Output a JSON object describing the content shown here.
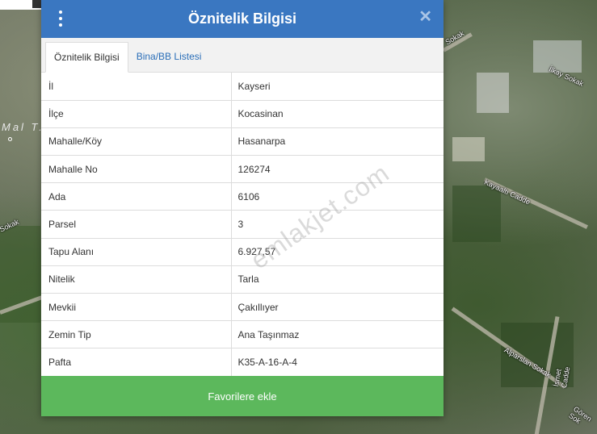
{
  "map": {
    "left_text": "Mal T.",
    "street_labels": [
      "Sokak",
      "İlkay Sokak",
      "Kayaaltı Cadde",
      "Sokak",
      "Alparslan Sokak",
      "İsmet Cadde",
      "Gören Sok"
    ]
  },
  "dialog": {
    "title": "Öznitelik Bilgisi",
    "close_symbol": "✕",
    "tabs": [
      {
        "label": "Öznitelik Bilgisi",
        "active": true
      },
      {
        "label": "Bina/BB Listesi",
        "active": false
      }
    ],
    "rows": [
      {
        "label": "İl",
        "value": "Kayseri"
      },
      {
        "label": "İlçe",
        "value": "Kocasinan"
      },
      {
        "label": "Mahalle/Köy",
        "value": "Hasanarpa"
      },
      {
        "label": "Mahalle No",
        "value": "126274"
      },
      {
        "label": "Ada",
        "value": "6106"
      },
      {
        "label": "Parsel",
        "value": "3"
      },
      {
        "label": "Tapu Alanı",
        "value": "6.927,57"
      },
      {
        "label": "Nitelik",
        "value": "Tarla"
      },
      {
        "label": "Mevkii",
        "value": "Çakıllıyer"
      },
      {
        "label": "Zemin Tip",
        "value": "Ana Taşınmaz"
      },
      {
        "label": "Pafta",
        "value": "K35-A-16-A-4"
      }
    ],
    "favorite_button": "Favorilere ekle",
    "watermark": "emlakjet.com"
  },
  "colors": {
    "header": "#3a77c1",
    "favorite": "#5cb85c",
    "tab_link": "#2a6eb8"
  }
}
